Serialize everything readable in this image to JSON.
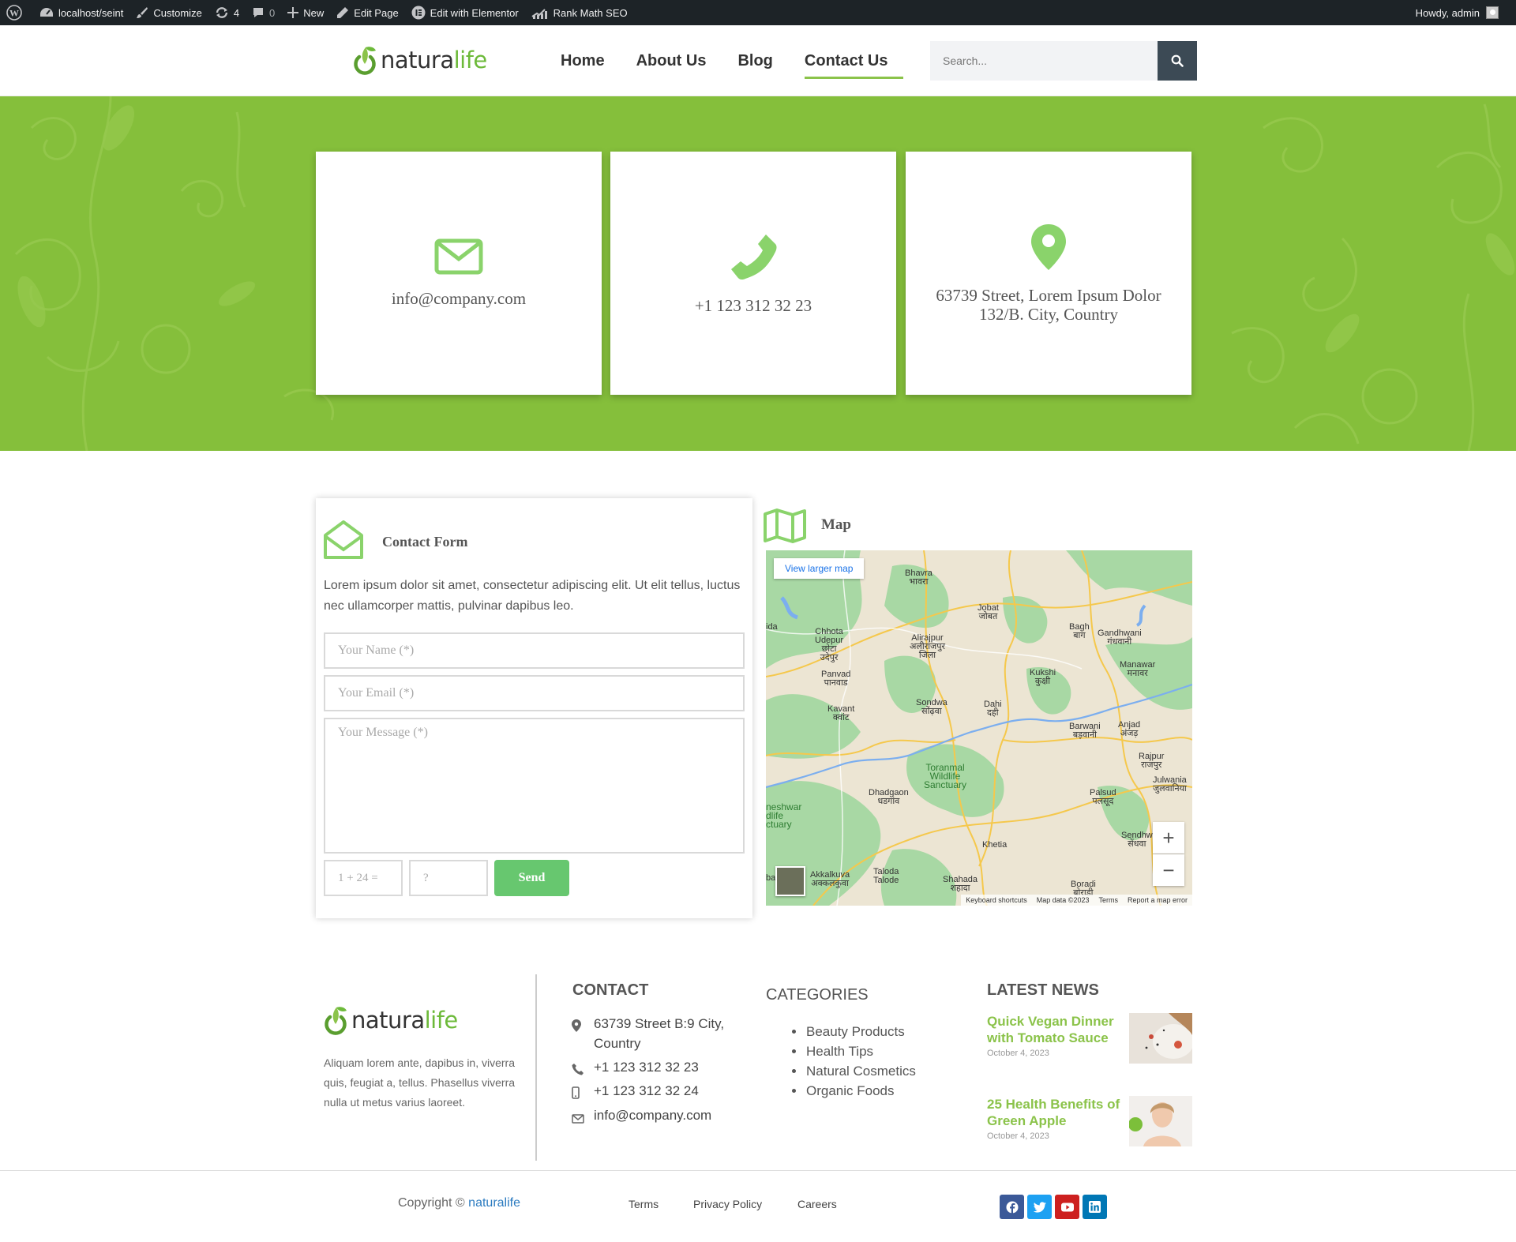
{
  "adminbar": {
    "site": "localhost/seint",
    "customize": "Customize",
    "updates": "4",
    "comments": "0",
    "new": "New",
    "edit_page": "Edit Page",
    "edit_elementor": "Edit with Elementor",
    "rank_math": "Rank Math SEO",
    "howdy": "Howdy, admin"
  },
  "header": {
    "logo_part1": "natura",
    "logo_part2": "life",
    "nav": [
      "Home",
      "About Us",
      "Blog",
      "Contact Us"
    ],
    "active_nav": "Contact Us",
    "search_placeholder": "Search..."
  },
  "hero": {
    "background_color": "#85bf3b",
    "cards": [
      {
        "icon": "envelope-icon",
        "text": "info@company.com"
      },
      {
        "icon": "phone-icon",
        "text": "+1 123 312 32 23"
      },
      {
        "icon": "location-pin-icon",
        "text": "63739 Street, Lorem Ipsum Dolor 132/B. City, Country"
      }
    ]
  },
  "contact_form": {
    "title": "Contact Form",
    "description": "Lorem ipsum dolor sit amet, consectetur adipiscing elit. Ut elit tellus, luctus nec ullamcorper mattis, pulvinar dapibus leo.",
    "name_placeholder": "Your Name (*)",
    "email_placeholder": "Your Email (*)",
    "message_placeholder": "Your Message (*)",
    "captcha_question": "1 + 24 =",
    "captcha_placeholder": "?",
    "send_label": "Send"
  },
  "map": {
    "title": "Map",
    "view_larger": "View larger map",
    "zoom_in": "+",
    "zoom_out": "−",
    "footer": [
      "Keyboard shortcuts",
      "Map data ©2023",
      "Terms",
      "Report a map error"
    ],
    "labels": {
      "bhavra": "Bhavra\nभावरा",
      "jobat": "Jobat\nजोबत",
      "bagh": "Bagh\nबाग",
      "gandhwani": "Gandhwani\nगंधवानी",
      "chhota_udepur": "Chhota\nUdepur\nछोटा\nउदेपुर",
      "alirajpur": "Alirajpur\nअलीराजपुर\nजिला",
      "manawar": "Manawar\nमनावर",
      "kukshi": "Kukshi\nकुक्षी",
      "panvad": "Panvad\nपानवाड",
      "sondwa": "Sondwa\nसोंढ़वा",
      "dahi": "Dahi\nदही",
      "kavant": "Kavant\nक्वांट",
      "barwani": "Barwani\nबड़वानी",
      "anjad": "Anjad\nअंजड़",
      "rajpur": "Rajpur\nराजपुर",
      "toranmal": "Toranmal\nWildlife\nSanctuary",
      "julwania": "Julwania\nजुलवानिया",
      "dhadgaon": "Dhadgaon\nधडगांव",
      "palsud": "Palsud\nपलसूद",
      "sanctuary_left": "neshwar\ndlife\nctuary",
      "sendhwa": "Sendhw\nसेंधवा",
      "khetia": "Khetia",
      "akkalkuva": "Akkalkuva\nअक्कलकुवा",
      "taloda": "Taloda\nTalode",
      "shahada": "Shahada\nशहादा",
      "boradi": "Boradi\nबोराडी",
      "ida": "ida",
      "ba": "ba"
    }
  },
  "footer": {
    "logo_part1": "natura",
    "logo_part2": "life",
    "about": "Aliquam lorem ante, dapibus in, viverra quis, feugiat a, tellus. Phasellus viverra nulla ut metus varius laoreet.",
    "contact_heading": "CONTACT",
    "contact": {
      "address": "63739 Street B:9 City, Country",
      "phone": "+1 123 312 32 23",
      "mobile": "+1 123 312 32 24",
      "email": "info@company.com"
    },
    "categories_heading": "CATEGORIES",
    "categories": [
      "Beauty Products",
      "Health Tips",
      "Natural Cosmetics",
      "Organic Foods"
    ],
    "news_heading": "LATEST NEWS",
    "news": [
      {
        "title": "Quick Vegan Dinner with Tomato Sauce",
        "date": "October 4, 2023"
      },
      {
        "title": "25 Health Benefits of Green Apple",
        "date": "October 4, 2023"
      }
    ]
  },
  "bottom_bar": {
    "copyright_prefix": "Copyright ©",
    "copyright_brand": "naturalife",
    "links": [
      "Terms",
      "Privacy Policy",
      "Careers"
    ],
    "social": [
      {
        "name": "facebook-icon",
        "color": "#3b5998"
      },
      {
        "name": "twitter-icon",
        "color": "#1da1f2"
      },
      {
        "name": "youtube-icon",
        "color": "#cd201f"
      },
      {
        "name": "linkedin-icon",
        "color": "#0077b5"
      }
    ]
  },
  "colors": {
    "accent_green": "#8bc34a",
    "icon_green": "#8ad36b",
    "send_green": "#67c76f",
    "admin_bar": "#1d2327",
    "search_button": "#3c4a55"
  }
}
